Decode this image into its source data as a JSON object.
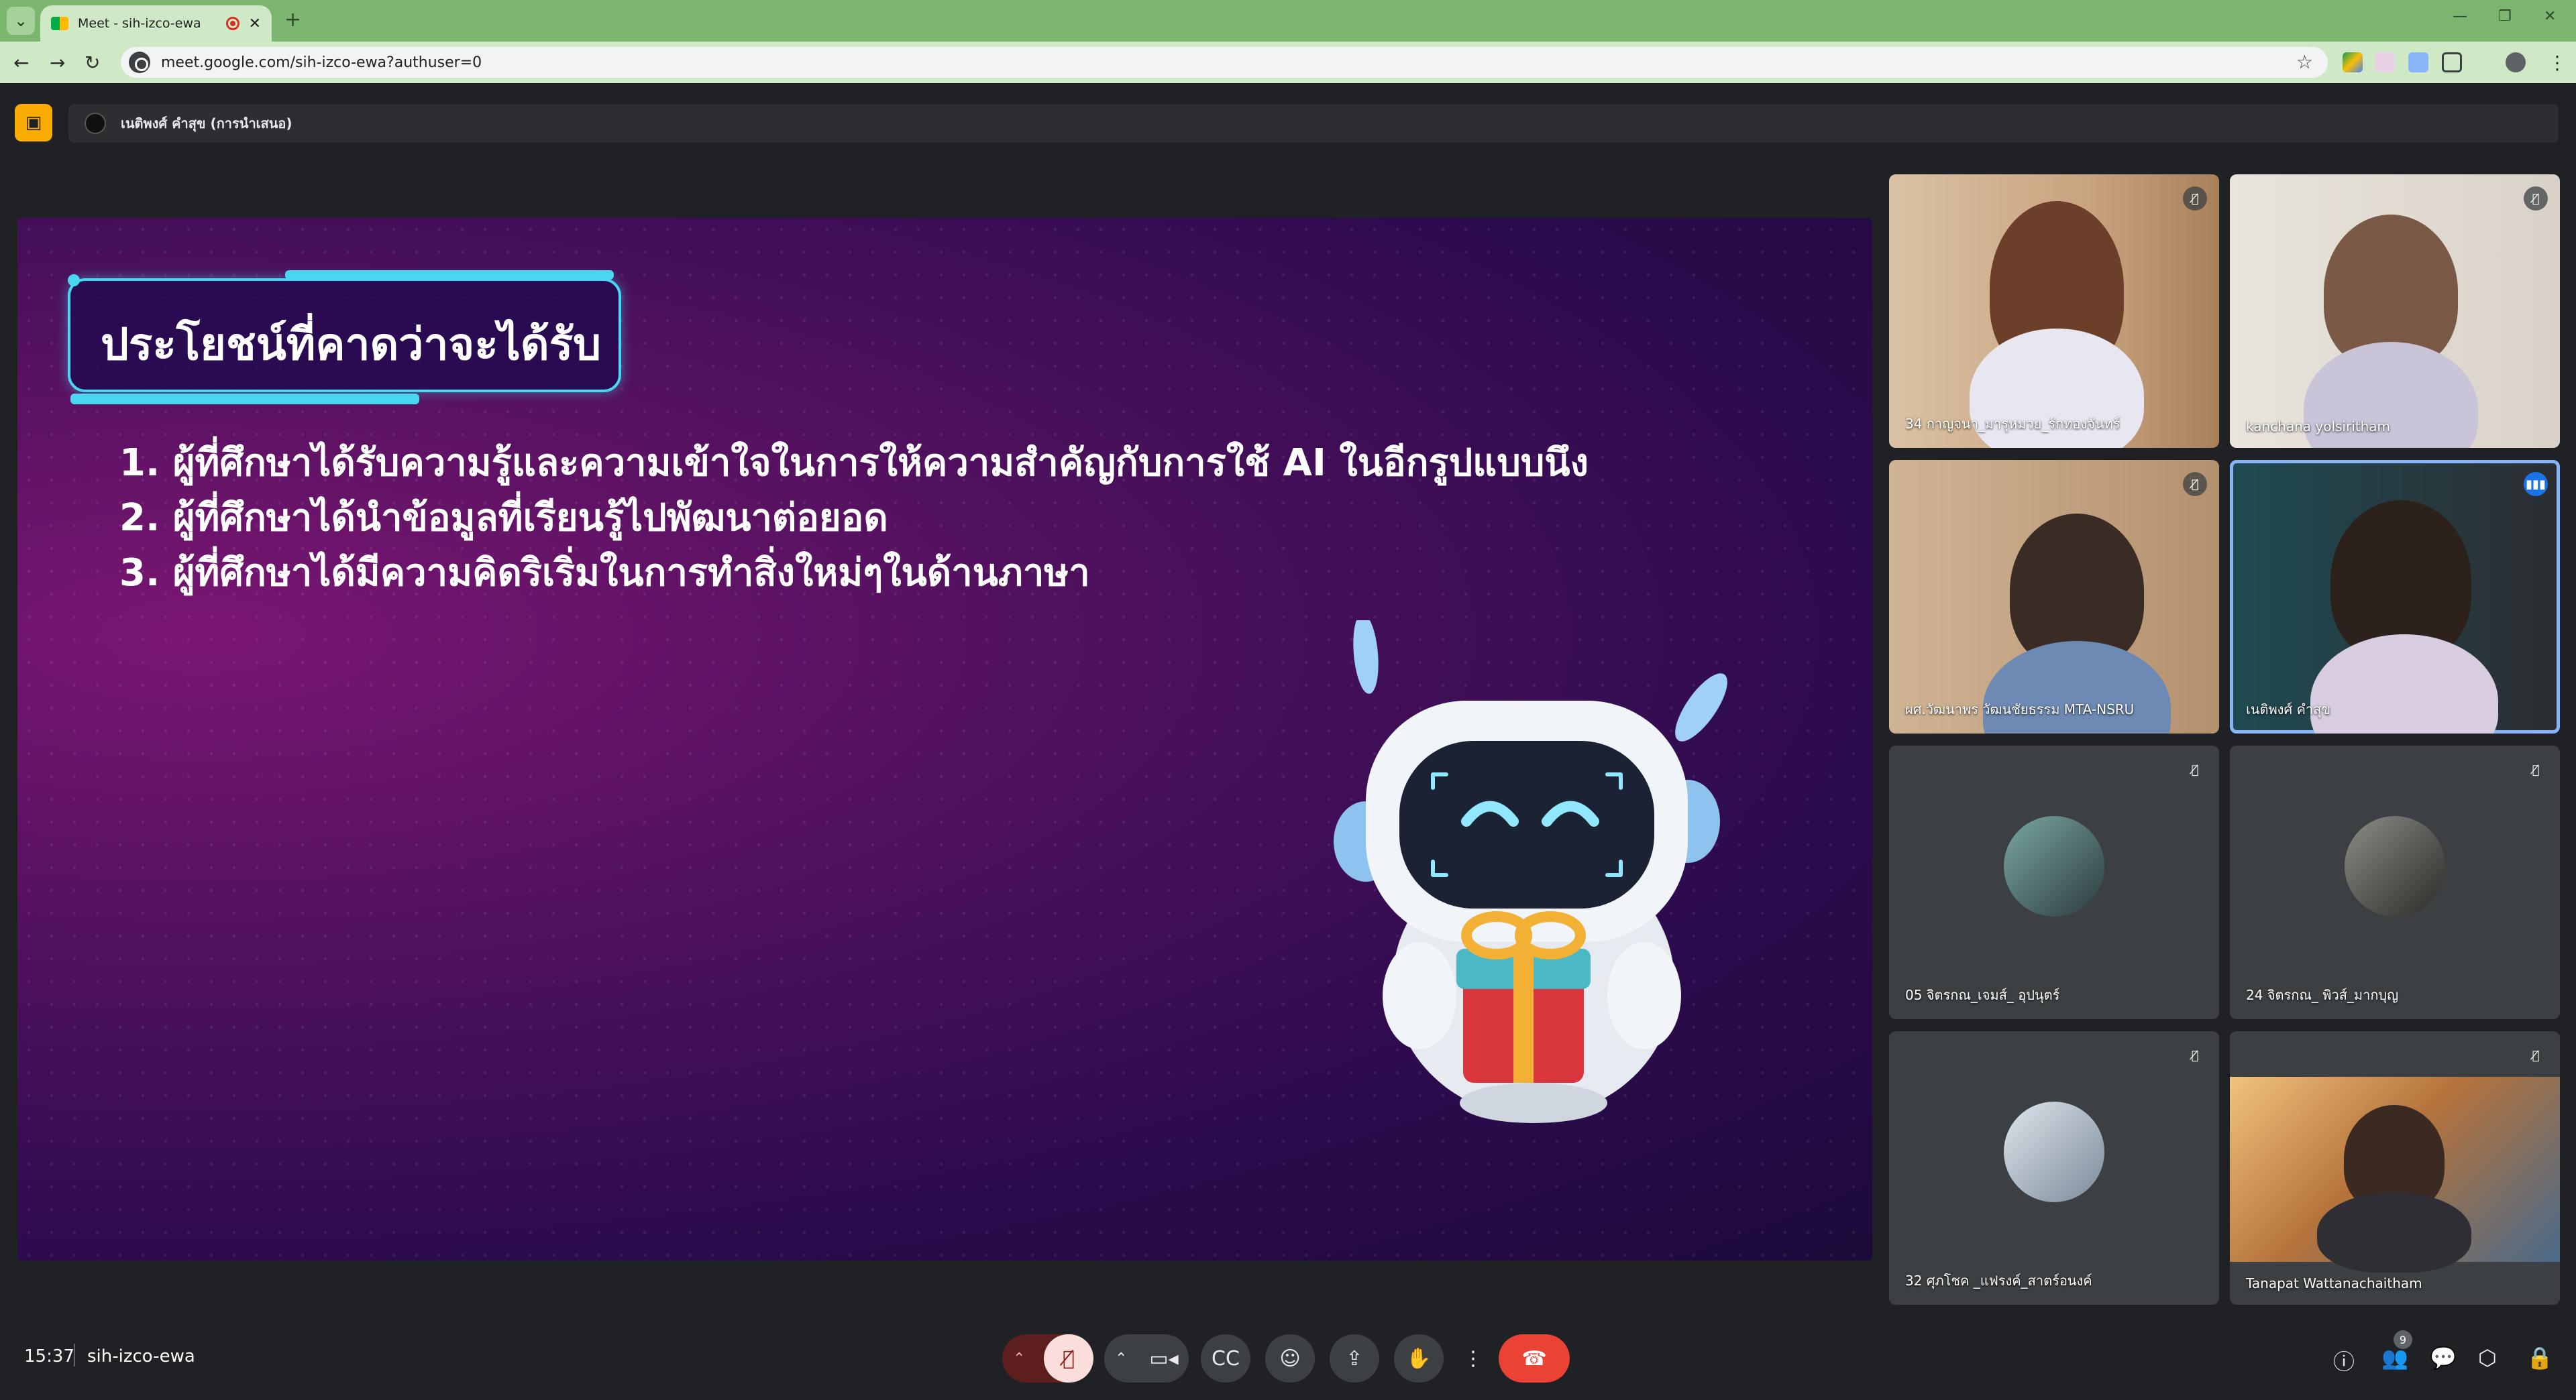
{
  "browser": {
    "tab_title": "Meet - sih-izco-ewa",
    "url": "meet.google.com/sih-izco-ewa?authuser=0"
  },
  "meet": {
    "presenter_name": "เนติพงศ์ คำสุข (การนำเสนอ)",
    "clock": "15:37",
    "meeting_code": "sih-izco-ewa",
    "people_count": "9",
    "colors": {
      "accent": "#8ab4f8",
      "end_call": "#ea4335",
      "present_badge": "#f9ab00"
    }
  },
  "slide": {
    "title": "ประโยชน์ที่คาดว่าจะได้รับ",
    "points": [
      "1. ผู้ที่ศึกษาได้รับความรู้และความเข้าใจในการให้ความสำคัญกับการใช้ AI ในอีกรูปแบบนึง",
      "2. ผู้ที่ศึกษาได้นำข้อมูลที่เรียนรู้ไปพัฒนาต่อยอด",
      "3. ผู้ที่ศึกษาได้มีความคิดริเริ่มในการทำสิ่งใหม่ๆในด้านภาษา"
    ]
  },
  "participants": [
    {
      "name": "34 กาญจนา_มารุหมวย_รักทองจันทร์",
      "muted": true
    },
    {
      "name": "kanchana yolsiritham",
      "muted": true
    },
    {
      "name": "ผศ.วัฒนาพร วัฒนชัยธรรม MTA-NSRU",
      "muted": true
    },
    {
      "name": "เนติพงศ์ คำสุข",
      "muted": false
    },
    {
      "name": "05 จิตรกณ_เจมส์_ อุปนุตร์",
      "muted": true
    },
    {
      "name": "24 จิตรกณ_ พิวส์_มากบุญ",
      "muted": true
    },
    {
      "name": "32 ศุภโชค _แฟรงค์_สาตร์อนงค์",
      "muted": true
    },
    {
      "name": "Tanapat Wattanachaitham",
      "muted": true
    }
  ]
}
